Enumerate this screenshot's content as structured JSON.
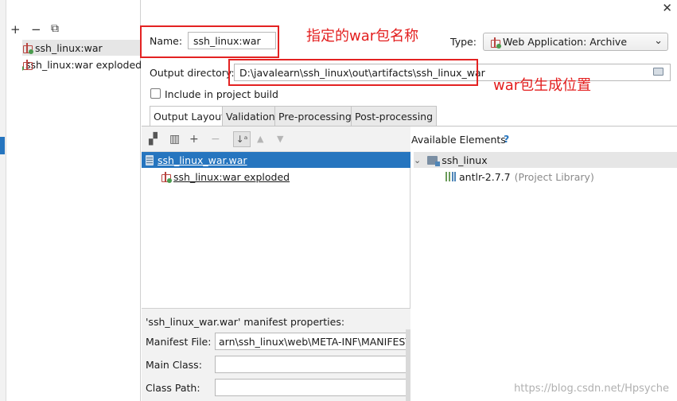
{
  "toolbar": {
    "add": "+",
    "remove": "−",
    "copy": "⧉"
  },
  "artifacts": [
    {
      "label": "ssh_linux:war",
      "selected": true
    },
    {
      "label": "ssh_linux:war exploded",
      "selected": false
    }
  ],
  "form": {
    "name_label": "Name:",
    "name_value": "ssh_linux:war",
    "type_label": "Type:",
    "type_value": "Web Application: Archive",
    "output_label": "Output directory:",
    "output_value": "D:\\javalearn\\ssh_linux\\out\\artifacts\\ssh_linux_war",
    "include_build_label": "Include in project build",
    "include_build_checked": false
  },
  "annotations": {
    "name_note": "指定的war包名称",
    "output_note": "war包生成位置",
    "color": "#e31e1e"
  },
  "tabs": [
    {
      "label": "Output Layout",
      "active": true
    },
    {
      "label": "Validation",
      "active": false
    },
    {
      "label": "Pre-processing",
      "active": false
    },
    {
      "label": "Post-processing",
      "active": false
    }
  ],
  "layout_tree": [
    {
      "label": "ssh_linux_war.war",
      "selected": true
    },
    {
      "label": "ssh_linux:war exploded",
      "selected": false
    }
  ],
  "available": {
    "title": "Available Elements",
    "help": "?",
    "module": "ssh_linux",
    "library_name": "antlr-2.7.7",
    "library_note": "(Project Library)"
  },
  "manifest": {
    "title": "'ssh_linux_war.war' manifest properties:",
    "file_label": "Manifest File:",
    "file_value": "arn\\ssh_linux\\web\\META-INF\\MANIFEST.M",
    "main_class_label": "Main Class:",
    "main_class_value": "",
    "class_path_label": "Class Path:",
    "class_path_value": ""
  },
  "watermark": "https://blog.csdn.net/Hpsyche",
  "colors": {
    "selection": "#2675bf",
    "annotation_box": "#e32222"
  },
  "icons": [
    "plus-icon",
    "minus-icon",
    "copy-icon",
    "war-artifact-icon",
    "folder-icon",
    "jar-icon",
    "library-icon",
    "module-icon",
    "sort-icon",
    "arrow-up-icon",
    "arrow-down-icon",
    "close-icon"
  ]
}
